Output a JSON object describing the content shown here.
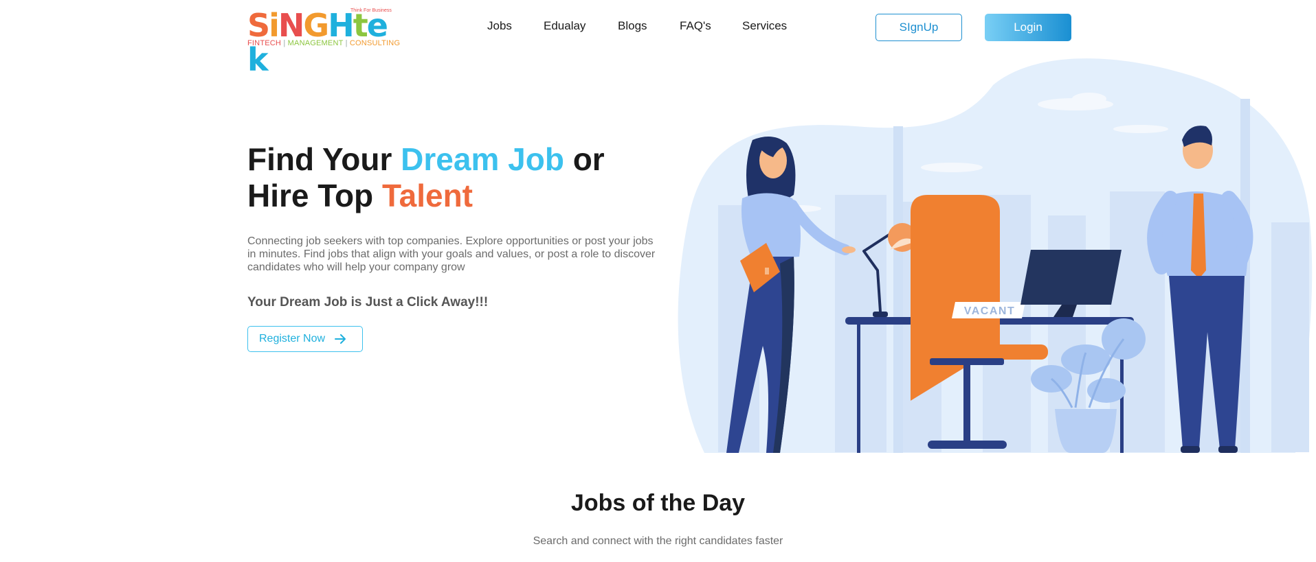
{
  "logo": {
    "letters": [
      "S",
      "i",
      "N",
      "G",
      "H",
      "t",
      "e",
      "k"
    ],
    "letter_colors": [
      "#ef6a3c",
      "#f29a2e",
      "#e84e4e",
      "#f29a2e",
      "#1fb0dd",
      "#8cc63f",
      "#1fb0dd",
      "#1fb0dd"
    ],
    "tag_1": "FINTECH",
    "tag_2": "MANAGEMENT",
    "tag_3": "CONSULTING",
    "separator": "|",
    "slogan": "Think For Business"
  },
  "nav": {
    "items": [
      "Jobs",
      "Edualay",
      "Blogs",
      "FAQ's",
      "Services"
    ]
  },
  "auth": {
    "signup_label": "SIgnUp",
    "login_label": "Login"
  },
  "hero": {
    "title_part1": "Find Your ",
    "title_highlight1": "Dream Job",
    "title_part2": " or",
    "title_part3": "Hire Top ",
    "title_highlight2": "Talent",
    "description": "Connecting job seekers with top companies. Explore opportunities or post your jobs in minutes. Find jobs that align with your goals and values, or post a role to discover candidates who will help your company grow",
    "subheading": "Your Dream Job is Just a Click Away!!!",
    "register_label": "Register Now",
    "vacant_sign": "VACANT"
  },
  "jobs_section": {
    "title": "Jobs of the Day",
    "subtitle": "Search and connect with the right candidates faster"
  },
  "colors": {
    "accent_blue": "#3cc1ee",
    "accent_orange": "#ef6a3c",
    "button_blue": "#1d8fd0",
    "illustration_bg": "#e3effc"
  }
}
